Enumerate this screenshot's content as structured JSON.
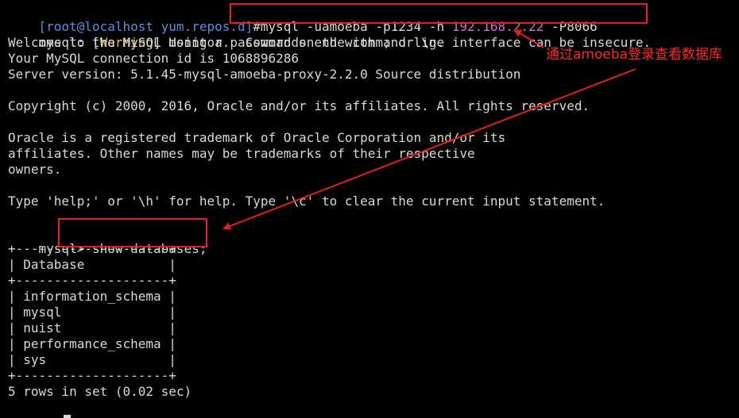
{
  "terminal": {
    "prompt": {
      "open_bracket": "[",
      "user_host": "root@localhost yum.repos.d",
      "close_bracket": "]",
      "hash": "#"
    },
    "command": {
      "part1": "mysql -uamoeba -p1234 -h ",
      "host_ip": "192.168.2.22",
      "part2": " -P8066"
    },
    "warning_line": {
      "prefix": "mysql: [",
      "tag": "Warning",
      "suffix": "] Using a password on the command line interface can be insecure."
    },
    "lines": [
      "Welcome to the MySQL monitor.  Commands end with ; or \\g.",
      "Your MySQL connection id is 1068896286",
      "Server version: 5.1.45-mysql-amoeba-proxy-2.2.0 Source distribution",
      "",
      "Copyright (c) 2000, 2016, Oracle and/or its affiliates. All rights reserved.",
      "",
      "Oracle is a registered trademark of Oracle Corporation and/or its",
      "affiliates. Other names may be trademarks of their respective",
      "owners.",
      "",
      "Type 'help;' or '\\h' for help. Type '\\c' to clear the current input statement.",
      ""
    ],
    "mysql_prompt": "mysql> ",
    "query": "show databases;",
    "table": {
      "border": "+--------------------+",
      "header": "| Database           |",
      "rows": [
        "| information_schema |",
        "| mysql              |",
        "| nuist              |",
        "| performance_schema |",
        "| sys                |"
      ]
    },
    "result_summary": "5 rows in set (0.02 sec)"
  },
  "annotation": {
    "label": "通过amoeba登录查看数据库",
    "color": "#e51e1e"
  },
  "colors": {
    "background": "#000000",
    "text": "#d8d8d8",
    "prompt_blue": "#5c8ddd",
    "warning_yellow": "#e5c04a",
    "ip_magenta": "#d76adc"
  }
}
